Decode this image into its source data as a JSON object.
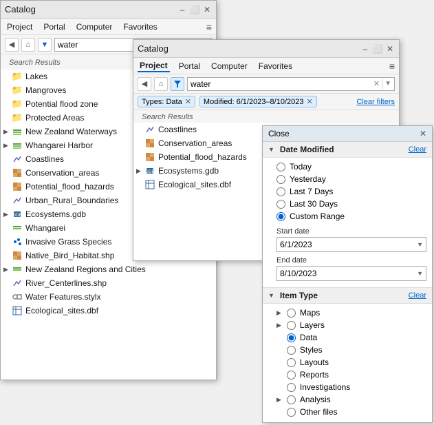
{
  "window1": {
    "title": "Catalog",
    "menu": [
      "Project",
      "Portal",
      "Computer",
      "Favorites"
    ],
    "search_value": "water",
    "search_results_label": "Search Results",
    "tree_items": [
      {
        "label": "Lakes",
        "icon": "folder",
        "depth": 0,
        "arrow": false
      },
      {
        "label": "Mangroves",
        "icon": "folder",
        "depth": 0,
        "arrow": false
      },
      {
        "label": "Potential flood zone",
        "icon": "folder",
        "depth": 0,
        "arrow": false
      },
      {
        "label": "Protected Areas",
        "icon": "folder",
        "depth": 0,
        "arrow": false
      },
      {
        "label": "New Zealand Waterways",
        "icon": "green-layer",
        "depth": 0,
        "arrow": true
      },
      {
        "label": "Whangarei Harbor",
        "icon": "green-layer",
        "depth": 0,
        "arrow": true
      },
      {
        "label": "Coastlines",
        "icon": "vector",
        "depth": 0,
        "arrow": false
      },
      {
        "label": "Conservation_areas",
        "icon": "raster",
        "depth": 0,
        "arrow": false
      },
      {
        "label": "Potential_flood_hazards",
        "icon": "raster",
        "depth": 0,
        "arrow": false
      },
      {
        "label": "Urban_Rural_Boundaries",
        "icon": "vector",
        "depth": 0,
        "arrow": false
      },
      {
        "label": "Ecosystems.gdb",
        "icon": "gdb",
        "depth": 0,
        "arrow": true
      },
      {
        "label": "Whangarei",
        "icon": "green-layer",
        "depth": 0,
        "arrow": false
      },
      {
        "label": "Invasive Grass Species",
        "icon": "point-layer",
        "depth": 0,
        "arrow": false
      },
      {
        "label": "Native_Bird_Habitat.shp",
        "icon": "raster",
        "depth": 0,
        "arrow": false
      },
      {
        "label": "New Zealand Regions and Cities",
        "icon": "green-layer",
        "depth": 0,
        "arrow": true
      },
      {
        "label": "River_Centerlines.shp",
        "icon": "vector",
        "depth": 0,
        "arrow": false
      },
      {
        "label": "Water Features.stylx",
        "icon": "style",
        "depth": 0,
        "arrow": false
      },
      {
        "label": "Ecological_sites.dbf",
        "icon": "table",
        "depth": 0,
        "arrow": false
      }
    ]
  },
  "window2": {
    "title": "Catalog",
    "menu": [
      "Project",
      "Portal",
      "Computer",
      "Favorites"
    ],
    "active_tab": "Project",
    "search_value": "water",
    "filter_tags": [
      {
        "label": "Types: Data",
        "key": "types_data"
      },
      {
        "label": "Modified: 6/1/2023–8/10/2023",
        "key": "modified_date"
      }
    ],
    "clear_filters_label": "Clear filters",
    "search_results_label": "Search Results",
    "tree_items": [
      {
        "label": "Coastlines",
        "icon": "vector",
        "depth": 0,
        "arrow": false
      },
      {
        "label": "Conservation_areas",
        "icon": "raster",
        "depth": 0,
        "arrow": false
      },
      {
        "label": "Potential_flood_hazards",
        "icon": "raster",
        "depth": 0,
        "arrow": false
      },
      {
        "label": "Ecosystems.gdb",
        "icon": "gdb",
        "depth": 0,
        "arrow": true
      },
      {
        "label": "Ecological_sites.dbf",
        "icon": "table",
        "depth": 0,
        "arrow": false
      }
    ]
  },
  "filter_panel": {
    "title": "Close",
    "date_modified_label": "Date Modified",
    "date_clear_label": "Clear",
    "radio_options": [
      "Today",
      "Yesterday",
      "Last 7 Days",
      "Last 30 Days",
      "Custom Range"
    ],
    "selected_radio": "Custom Range",
    "start_date_label": "Start date",
    "start_date_value": "6/1/2023",
    "end_date_label": "End date",
    "end_date_value": "8/10/2023",
    "item_type_label": "Item Type",
    "item_type_clear_label": "Clear",
    "item_types": [
      {
        "label": "Maps",
        "selected": false,
        "expandable": true
      },
      {
        "label": "Layers",
        "selected": false,
        "expandable": true
      },
      {
        "label": "Data",
        "selected": true,
        "expandable": false
      },
      {
        "label": "Styles",
        "selected": false,
        "expandable": false
      },
      {
        "label": "Layouts",
        "selected": false,
        "expandable": false
      },
      {
        "label": "Reports",
        "selected": false,
        "expandable": false
      },
      {
        "label": "Investigations",
        "selected": false,
        "expandable": false
      },
      {
        "label": "Analysis",
        "selected": false,
        "expandable": true
      },
      {
        "label": "Other files",
        "selected": false,
        "expandable": false
      }
    ]
  }
}
